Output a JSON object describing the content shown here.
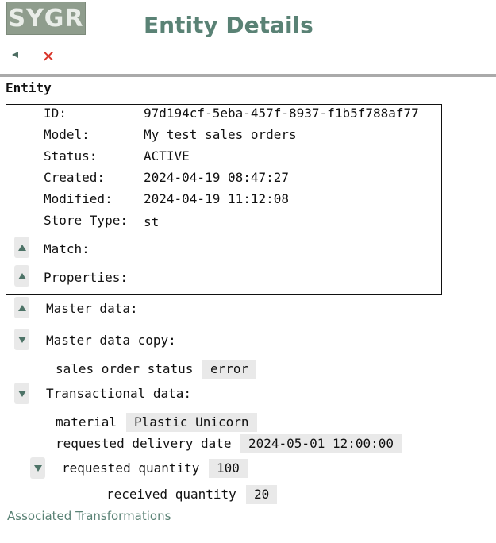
{
  "header": {
    "logo_text": "SYGR",
    "title": "Entity Details"
  },
  "toolbar": {
    "back_icon": "back-arrow-icon",
    "close_icon": "close-icon",
    "close_glyph": "✕"
  },
  "section_title": "Entity",
  "entity": {
    "id_label": "ID:",
    "id": "97d194cf-5eba-457f-8937-f1b5f788af77",
    "model_label": "Model:",
    "model": "My test sales orders",
    "status_label": "Status:",
    "status": "ACTIVE",
    "created_label": "Created:",
    "created": "2024-04-19 08:47:27",
    "modified_label": "Modified:",
    "modified": "2024-04-19 11:12:08",
    "store_type_label": "Store Type:",
    "store_type": "st",
    "match_label": "Match:",
    "properties_label": "Properties:"
  },
  "master_data": {
    "label": "Master data:"
  },
  "master_data_copy": {
    "label": "Master data copy:",
    "sales_order_status_label": "sales order status",
    "sales_order_status": "error"
  },
  "transactional_data": {
    "label": "Transactional data:",
    "material_label": "material",
    "material": "Plastic Unicorn",
    "requested_delivery_date_label": "requested delivery date",
    "requested_delivery_date": "2024-05-01 12:00:00",
    "requested_quantity_label": "requested quantity",
    "requested_quantity": "100",
    "received_quantity_label": "received quantity",
    "received_quantity": "20"
  },
  "footer": {
    "associated_transformations": "Associated Transformations"
  },
  "colors": {
    "accent": "#5a8275",
    "close": "#d9352a",
    "value_bg": "#e9e9e9"
  }
}
